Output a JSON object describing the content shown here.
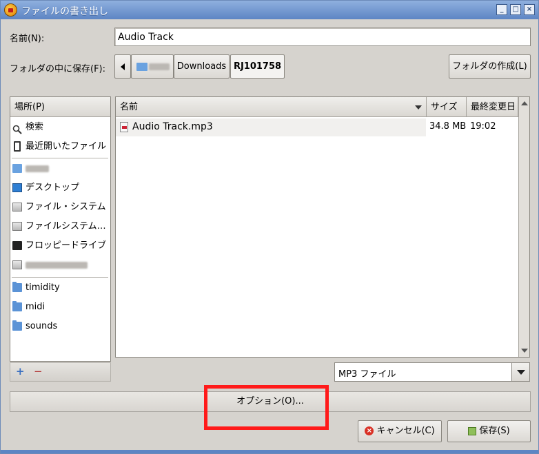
{
  "window": {
    "title": "ファイルの書き出し"
  },
  "name_row": {
    "label": "名前(N):",
    "value": "Audio Track"
  },
  "folder_row": {
    "label": "フォルダの中に保存(F):",
    "path": [
      "Downloads",
      "RJ101758"
    ],
    "create_folder_label": "フォルダの作成(L)"
  },
  "places": {
    "header": "場所(P)",
    "items": [
      {
        "label": "検索",
        "icon": "search-icon"
      },
      {
        "label": "最近開いたファイル",
        "icon": "recent-icon"
      },
      {
        "label": "デスクトップ",
        "icon": "desktop-icon"
      },
      {
        "label": "ファイル・システム",
        "icon": "drive-icon"
      },
      {
        "label": "ファイルシステム…",
        "icon": "drive-icon"
      },
      {
        "label": "フロッピードライブ",
        "icon": "floppy-icon"
      }
    ],
    "bookmarks": [
      "timidity",
      "midi",
      "sounds"
    ],
    "add_label": "+",
    "remove_label": "−"
  },
  "files": {
    "columns": {
      "name": "名前",
      "size": "サイズ",
      "modified": "最終変更日"
    },
    "rows": [
      {
        "name": "Audio Track.mp3",
        "size": "34.8 MB",
        "modified": "19:02"
      }
    ]
  },
  "filter": {
    "selected": "MP3 ファイル"
  },
  "options_label": "オプション(O)...",
  "buttons": {
    "cancel": "キャンセル(C)",
    "save": "保存(S)"
  },
  "colors": {
    "titlebar": "#5d85c4",
    "highlight": "#ff0000",
    "folder": "#5b93d6"
  }
}
